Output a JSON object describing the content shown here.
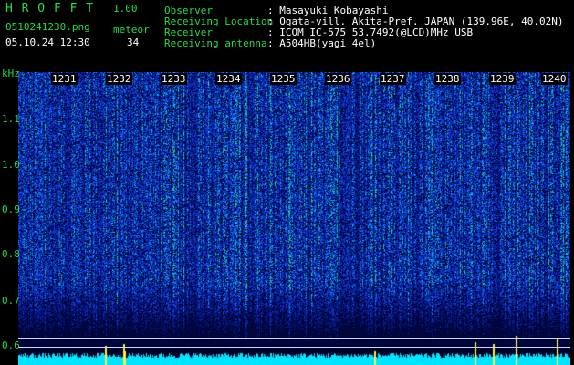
{
  "app": {
    "name": "H R O F F T",
    "version": "1.00"
  },
  "file": {
    "name": "0510241230.png",
    "datetime": "05.10.24 12:30",
    "meteor_label": "meteor",
    "meteor_count": "34"
  },
  "info": {
    "observer_label": "Observer",
    "observer_value": ": Masayuki Kobayashi",
    "location_label": "Receiving Location",
    "location_value": ": Ogata-vill. Akita-Pref. JAPAN (139.96E, 40.02N)",
    "receiver_label": "Receiver",
    "receiver_value": ": ICOM IC-575 53.7492(@LCD)MHz USB",
    "antenna_label": "Receiving antenna",
    "antenna_value": ": A504HB(yagi 4el)"
  },
  "yaxis": {
    "unit": "kHz",
    "labels": [
      "1.1",
      "1.0",
      "0.9",
      "0.8",
      "0.7",
      "0.6"
    ]
  },
  "time_ticks": [
    "1231",
    "1232",
    "1233",
    "1234",
    "1235",
    "1236",
    "1237",
    "1238",
    "1239",
    "1240"
  ],
  "colors": {
    "accent_green": "#22dd44",
    "spectrogram_bg": "#000033",
    "baseline_cyan": "#00e5ff",
    "meteor_yellow": "#ffee44"
  }
}
